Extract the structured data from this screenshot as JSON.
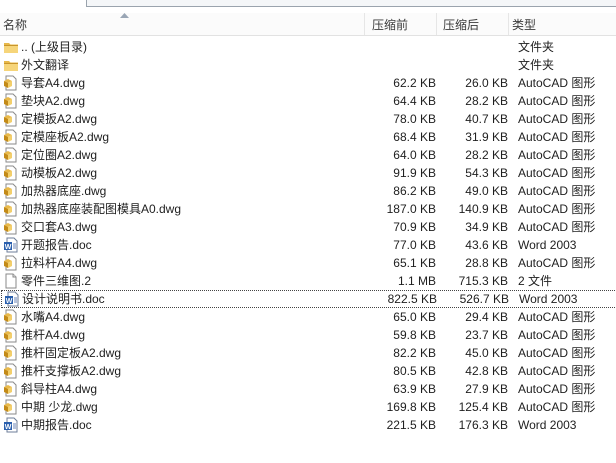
{
  "columns": {
    "name": "名称",
    "compressed_size": "压缩前",
    "packed_size": "压缩后",
    "type": "类型"
  },
  "rows": [
    {
      "icon": "folder-up-icon",
      "name": ".. (上级目录)",
      "size": "",
      "packed": "",
      "type": "文件夹"
    },
    {
      "icon": "folder-icon",
      "name": "外文翻译",
      "size": "",
      "packed": "",
      "type": "文件夹"
    },
    {
      "icon": "dwg-file-icon",
      "name": "导套A4.dwg",
      "size": "62.2 KB",
      "packed": "26.0 KB",
      "type": "AutoCAD 图形"
    },
    {
      "icon": "dwg-file-icon",
      "name": "垫块A2.dwg",
      "size": "64.4 KB",
      "packed": "28.2 KB",
      "type": "AutoCAD 图形"
    },
    {
      "icon": "dwg-file-icon",
      "name": "定模扳A2.dwg",
      "size": "78.0 KB",
      "packed": "40.7 KB",
      "type": "AutoCAD 图形"
    },
    {
      "icon": "dwg-file-icon",
      "name": "定模座板A2.dwg",
      "size": "68.4 KB",
      "packed": "31.9 KB",
      "type": "AutoCAD 图形"
    },
    {
      "icon": "dwg-file-icon",
      "name": "定位圈A2.dwg",
      "size": "64.0 KB",
      "packed": "28.2 KB",
      "type": "AutoCAD 图形"
    },
    {
      "icon": "dwg-file-icon",
      "name": "动模板A2.dwg",
      "size": "91.9 KB",
      "packed": "54.3 KB",
      "type": "AutoCAD 图形"
    },
    {
      "icon": "dwg-file-icon",
      "name": "加热器底座.dwg",
      "size": "86.2 KB",
      "packed": "49.0 KB",
      "type": "AutoCAD 图形"
    },
    {
      "icon": "dwg-file-icon",
      "name": "加热器底座装配图模具A0.dwg",
      "size": "187.0 KB",
      "packed": "140.9 KB",
      "type": "AutoCAD 图形"
    },
    {
      "icon": "dwg-file-icon",
      "name": "交口套A3.dwg",
      "size": "70.9 KB",
      "packed": "34.9 KB",
      "type": "AutoCAD 图形"
    },
    {
      "icon": "word-doc-icon",
      "name": "开题报告.doc",
      "size": "77.0 KB",
      "packed": "43.6 KB",
      "type": "Word 2003"
    },
    {
      "icon": "dwg-file-icon",
      "name": "拉料杆A4.dwg",
      "size": "65.1 KB",
      "packed": "28.8 KB",
      "type": "AutoCAD 图形"
    },
    {
      "icon": "blank-file-icon",
      "name": "零件三维图.2",
      "size": "1.1 MB",
      "packed": "715.3 KB",
      "type": "2 文件"
    },
    {
      "icon": "word-doc-icon",
      "name": "设计说明书.doc",
      "size": "822.5 KB",
      "packed": "526.7 KB",
      "type": "Word 2003",
      "focused": true
    },
    {
      "icon": "dwg-file-icon",
      "name": "水嘴A4.dwg",
      "size": "65.0 KB",
      "packed": "29.4 KB",
      "type": "AutoCAD 图形"
    },
    {
      "icon": "dwg-file-icon",
      "name": "推杆A4.dwg",
      "size": "59.8 KB",
      "packed": "23.7 KB",
      "type": "AutoCAD 图形"
    },
    {
      "icon": "dwg-file-icon",
      "name": "推杆固定板A2.dwg",
      "size": "82.2 KB",
      "packed": "45.0 KB",
      "type": "AutoCAD 图形"
    },
    {
      "icon": "dwg-file-icon",
      "name": "推杆支撑板A2.dwg",
      "size": "80.5 KB",
      "packed": "42.8 KB",
      "type": "AutoCAD 图形"
    },
    {
      "icon": "dwg-file-icon",
      "name": "斜导柱A4.dwg",
      "size": "63.9 KB",
      "packed": "27.9 KB",
      "type": "AutoCAD 图形"
    },
    {
      "icon": "dwg-file-icon",
      "name": "中期 少龙.dwg",
      "size": "169.8 KB",
      "packed": "125.4 KB",
      "type": "AutoCAD 图形"
    },
    {
      "icon": "word-doc-icon",
      "name": "中期报告.doc",
      "size": "221.5 KB",
      "packed": "176.3 KB",
      "type": "Word 2003"
    }
  ]
}
